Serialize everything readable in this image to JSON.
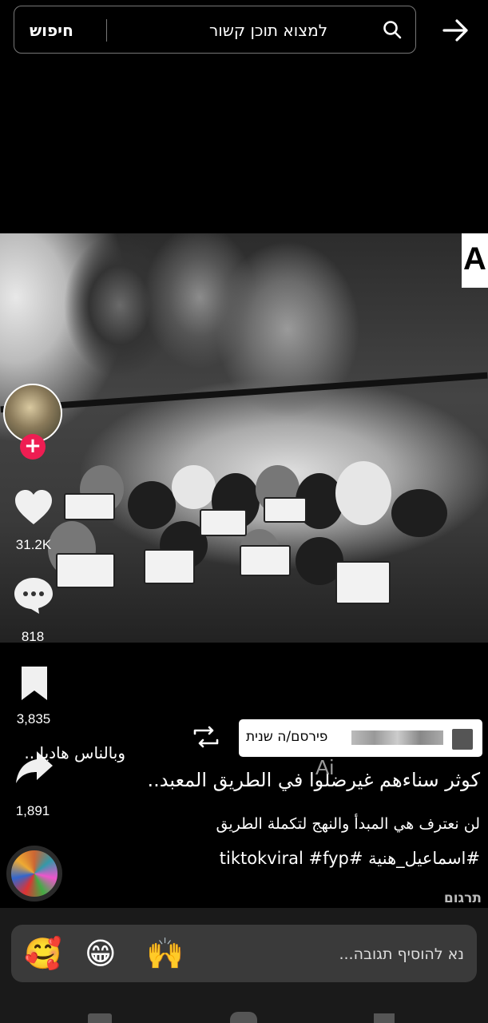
{
  "top_bar": {
    "search_button_label": "חיפוש",
    "search_query": "למצוא תוכן קשור"
  },
  "right_rail": {
    "likes": "31.2K",
    "comments": "818",
    "saves": "3,835",
    "shares": "1,891"
  },
  "video": {
    "watermark": "A"
  },
  "caption": {
    "posted_label": "פירסם/ה שנית",
    "line1": "وبالناس هاديا ..",
    "line2": "كوثر سناءهم غيرضلوا في الطريق المعبد..",
    "overlay_text": "Ai",
    "line3": "لن نعترف هي المبدأ والنهج لتكملة الطريق",
    "hashtags": "#اسماعيل_هنية #tiktokviral #fyp",
    "translate_label": "תרגום"
  },
  "comment_bar": {
    "placeholder": "נא להוסיף תגובה...",
    "emojis": [
      "🥰",
      "😁",
      "🙌"
    ]
  }
}
